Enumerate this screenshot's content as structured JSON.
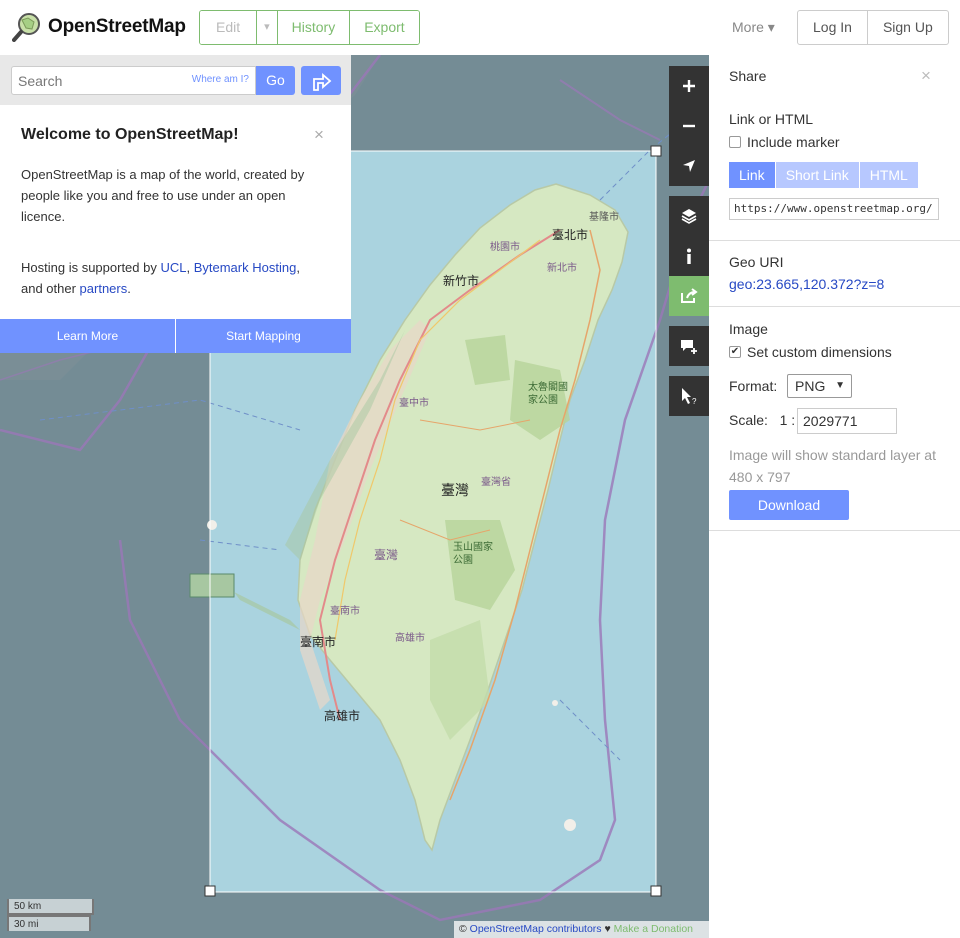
{
  "header": {
    "logo_text": "OpenStreetMap",
    "nav": {
      "edit": "Edit",
      "edit_dropdown": "▾",
      "history": "History",
      "export": "Export"
    },
    "more": "More ▾",
    "login": "Log In",
    "signup": "Sign Up",
    "colors": {
      "accent_green": "#7ebc6f",
      "accent_blue": "#7092ff"
    }
  },
  "search": {
    "placeholder": "Search",
    "where_am_i": "Where am I?",
    "go": "Go",
    "directions_icon": "directions-icon"
  },
  "welcome": {
    "title": "Welcome to OpenStreetMap!",
    "close": "×",
    "intro": "OpenStreetMap is a map of the world, created by people like you and free to use under an open licence.",
    "hosting_prefix": "Hosting is supported by ",
    "ucl": "UCL",
    "comma": ", ",
    "bytemark": "Bytemark Hosting",
    "and_other": ", and other ",
    "partners": "partners",
    "period": ".",
    "learn_more": "Learn More",
    "start_mapping": "Start Mapping"
  },
  "map": {
    "labels": {
      "keelung": "基隆市",
      "taipei": "臺北市",
      "taoyuan": "桃園市",
      "new_taipei": "新北市",
      "hsinchu": "新竹市",
      "taichung": "臺中市",
      "taroko": "太魯閣國\n家公園",
      "taiwan_big": "臺灣",
      "taiwan_prov": "臺灣省",
      "taiwan_mid": "臺灣",
      "yushan": "玉山國家\n公園",
      "tainan_dist": "臺南市",
      "kaohsiung_dist": "高雄市",
      "tainan": "臺南市",
      "kaohsiung": "高雄市"
    },
    "controls": [
      "zoom-in-icon",
      "zoom-out-icon",
      "locate-icon",
      "layers-icon",
      "info-icon",
      "share-icon",
      "note-icon",
      "query-icon"
    ]
  },
  "scale": {
    "km": "50 km",
    "mi": "30 mi"
  },
  "attribution": {
    "copy": "© ",
    "contributors": "OpenStreetMap contributors",
    "heart": " ♥ ",
    "donate": "Make a Donation"
  },
  "share": {
    "title": "Share",
    "close": "×",
    "link_or_html": "Link or HTML",
    "include_marker": "Include marker",
    "tabs": {
      "link": "Link",
      "short_link": "Short Link",
      "html": "HTML"
    },
    "url": "https://www.openstreetmap.org/",
    "geo_uri_label": "Geo URI",
    "geo_uri": "geo:23.665,120.372?z=8",
    "image_label": "Image",
    "set_custom": "Set custom dimensions",
    "format_label": "Format:",
    "format_value": "PNG",
    "scale_label": "Scale:",
    "scale_prefix": "1 :",
    "scale_value": "2029771",
    "note": "Image will show standard layer at 480 x 797",
    "download": "Download"
  }
}
